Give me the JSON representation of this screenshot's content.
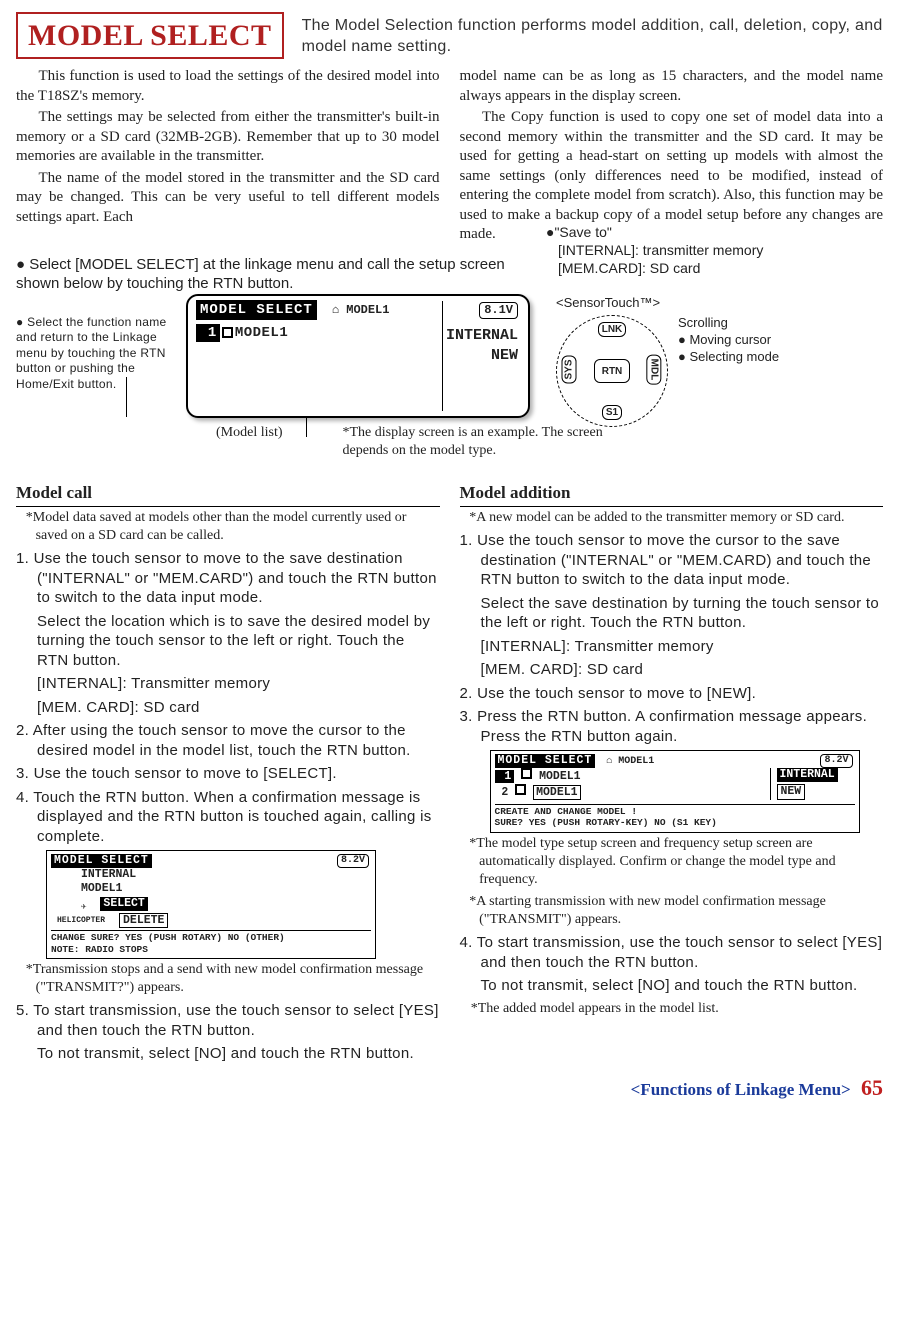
{
  "header": {
    "title": "MODEL SELECT",
    "subtitle": "The Model Selection function performs model addition, call, deletion, copy, and model name setting."
  },
  "intro_left": {
    "p1": "This function is used to load the settings of the desired model into the T18SZ's memory.",
    "p2": "The settings may be selected from either the transmitter's built-in memory or a SD card (32MB-2GB). Remember that up to 30 model memories are available in the transmitter.",
    "p3": "The name of the model stored in the transmitter and the SD card may be changed. This can be very useful to tell different models settings apart. Each"
  },
  "intro_right": {
    "p1": "model name can be as long as 15 characters, and the model name always appears in the display screen.",
    "p2": "The Copy function is used to copy one set of model data into a second memory within the transmitter and the SD card. It may be used for getting a head-start on setting up models with almost the same settings (only differences need to be modified, instead of entering the complete model from scratch). Also, this function may be used to make a backup copy of a model setup before any changes are made."
  },
  "middle": {
    "select_instruction": "● Select [MODEL SELECT] at the linkage menu and call the setup screen shown below by touching the RTN button.",
    "left_note": "● Select the function name and return to the Linkage menu by touching the RTN button or pushing the Home/Exit button.",
    "lcd": {
      "title": "MODEL SELECT",
      "top_model": "MODEL1",
      "voltage": "8.1V",
      "line_model": "MODEL1",
      "side1": "INTERNAL",
      "side2": "NEW"
    },
    "save_to": {
      "head": "●\"Save to\"",
      "l1": "[INTERNAL]: transmitter memory",
      "l2": "[MEM.CARD]: SD card"
    },
    "sensor": {
      "title": "<SensorTouch™>",
      "s1": "Scrolling",
      "s2": "● Moving cursor",
      "s3": "● Selecting mode",
      "lnk": "LNK",
      "rtn": "RTN",
      "s1b": "S1",
      "sys": "SYS",
      "mdl": "MDL"
    },
    "below": {
      "mlist": "(Model list)",
      "note": "*The display screen is an example. The screen depends on the model type."
    }
  },
  "model_call": {
    "heading": "Model call",
    "note0": "*Model data saved at models other than the model currently used or saved on a SD card can be called.",
    "s1": "1. Use the touch sensor to move to the save destination (\"INTERNAL\" or \"MEM.CARD\") and touch the RTN button to switch to the data input mode.",
    "s1b": "Select the location which is to save the desired model by turning the touch sensor to the left or right. Touch the RTN button.",
    "s1c": "[INTERNAL]: Transmitter memory",
    "s1d": "[MEM. CARD]: SD card",
    "s2": "2. After using the touch sensor to move the cursor to the desired model in the model list, touch the RTN button.",
    "s3": "3. Use the touch sensor to move to [SELECT].",
    "s4": "4. Touch the RTN button. When a confirmation message is displayed and the RTN button is touched again, calling is complete.",
    "lcd": {
      "title": "MODEL SELECT",
      "voltage": "8.2V",
      "l1": "INTERNAL",
      "l2": "MODEL1",
      "heli": "HELICOPTER",
      "sel": "SELECT",
      "del": "DELETE",
      "msg1": "CHANGE SURE? YES (PUSH ROTARY) NO (OTHER)",
      "msg2": "NOTE: RADIO STOPS"
    },
    "note1": "*Transmission stops and a send with new model confirmation message (\"TRANSMIT?\") appears.",
    "s5": "5. To start transmission, use the touch sensor to select [YES] and then touch the RTN button.",
    "s5b": "To not transmit, select [NO] and touch the RTN button."
  },
  "model_add": {
    "heading": "Model addition",
    "note0": "*A new model can be added to the transmitter memory or SD card.",
    "s1": "1. Use the touch sensor to move the cursor to the save destination (\"INTERNAL\" or \"MEM.CARD) and touch the RTN button to switch to the data input mode.",
    "s1b": "Select the save destination by turning the touch sensor to the left or right. Touch the RTN button.",
    "s1c": "[INTERNAL]: Transmitter memory",
    "s1d": "[MEM. CARD]: SD card",
    "s2": "2. Use the touch sensor to move to [NEW].",
    "s3": "3. Press the RTN button. A confirmation message appears. Press the RTN button again.",
    "lcd": {
      "title": "MODEL SELECT",
      "top_model": "MODEL1",
      "voltage": "8.2V",
      "row1": "MODEL1",
      "row2": "MODEL1",
      "side1": "INTERNAL",
      "side2": "NEW",
      "msg1": "CREATE AND CHANGE MODEL !",
      "msg2": "SURE? YES (PUSH ROTARY-KEY) NO (S1 KEY)"
    },
    "note1": "*The model type setup screen and frequency setup screen are automatically displayed. Confirm or change the model type and frequency.",
    "note2": "*A starting transmission with new model confirmation message (\"TRANSMIT\") appears.",
    "s4": "4. To start transmission, use the touch sensor to select [YES] and then touch the RTN button.",
    "s4b": "To not transmit, select [NO] and touch the RTN button.",
    "note3": "*The added model appears in the model list."
  },
  "footer": {
    "text": "<Functions of Linkage Menu>",
    "page": "65"
  }
}
